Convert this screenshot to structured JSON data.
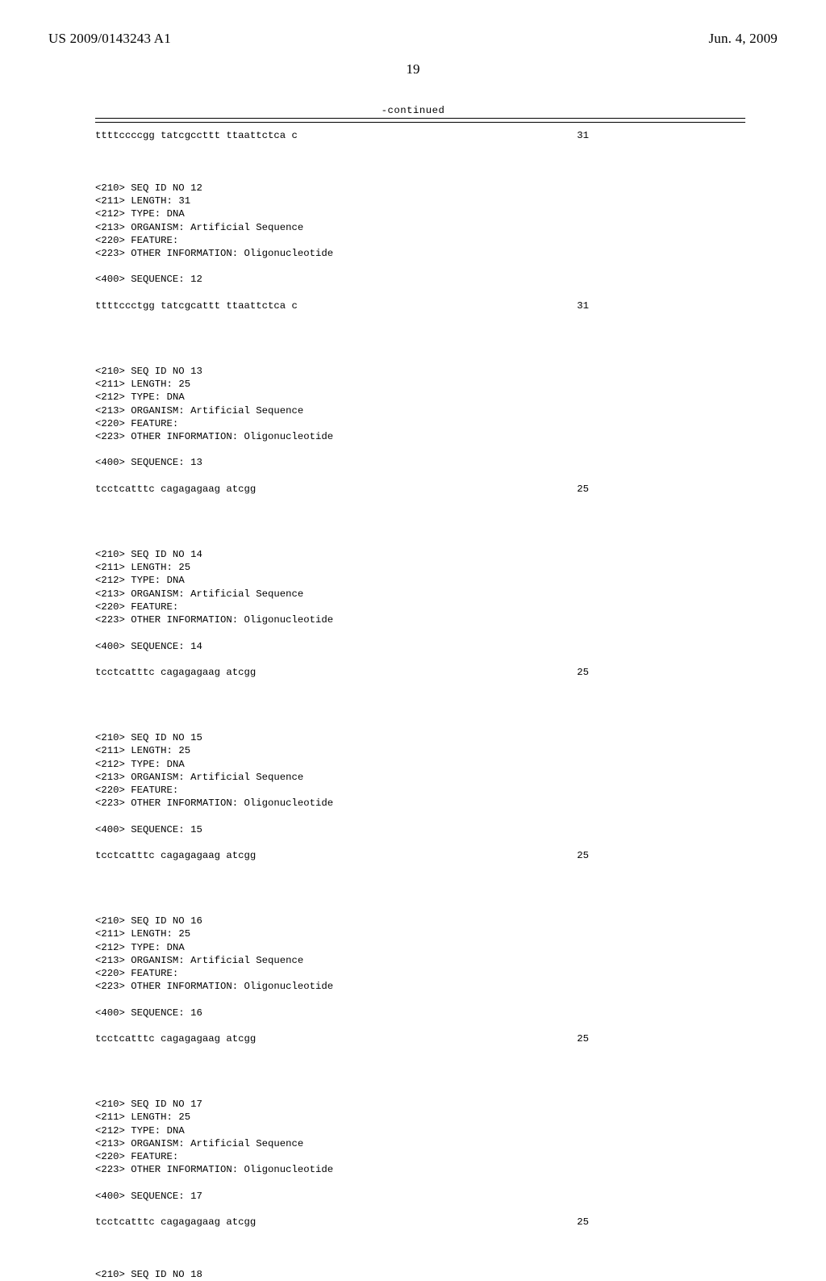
{
  "header": {
    "pub_no": "US 2009/0143243 A1",
    "pub_date": "Jun. 4, 2009"
  },
  "page_number": "19",
  "continued_label": "-continued",
  "prev_seq": {
    "text": "ttttccccgg tatcgccttt ttaattctca c",
    "len": "31"
  },
  "entries": [
    {
      "id": "12",
      "length": "31",
      "type": "DNA",
      "organism": "Artificial Sequence",
      "feature": "",
      "other": "Oligonucleotide",
      "seq_text": "ttttccctgg tatcgcattt ttaattctca c",
      "seq_len": "31"
    },
    {
      "id": "13",
      "length": "25",
      "type": "DNA",
      "organism": "Artificial Sequence",
      "feature": "",
      "other": "Oligonucleotide",
      "seq_text": "tcctcatttc cagagagaag atcgg",
      "seq_len": "25"
    },
    {
      "id": "14",
      "length": "25",
      "type": "DNA",
      "organism": "Artificial Sequence",
      "feature": "",
      "other": "Oligonucleotide",
      "seq_text": "tcctcatttc cagagagaag atcgg",
      "seq_len": "25"
    },
    {
      "id": "15",
      "length": "25",
      "type": "DNA",
      "organism": "Artificial Sequence",
      "feature": "",
      "other": "Oligonucleotide",
      "seq_text": "tcctcatttc cagagagaag atcgg",
      "seq_len": "25"
    },
    {
      "id": "16",
      "length": "25",
      "type": "DNA",
      "organism": "Artificial Sequence",
      "feature": "",
      "other": "Oligonucleotide",
      "seq_text": "tcctcatttc cagagagaag atcgg",
      "seq_len": "25"
    },
    {
      "id": "17",
      "length": "25",
      "type": "DNA",
      "organism": "Artificial Sequence",
      "feature": "",
      "other": "Oligonucleotide",
      "seq_text": "tcctcatttc cagagagaag atcgg",
      "seq_len": "25"
    }
  ],
  "next_entry_id": "18",
  "labels": {
    "seq_id": "<210> SEQ ID NO ",
    "length": "<211> LENGTH: ",
    "type": "<212> TYPE: ",
    "organism": "<213> ORGANISM: ",
    "feature": "<220> FEATURE:",
    "other": "<223> OTHER INFORMATION: ",
    "sequence": "<400> SEQUENCE: "
  }
}
